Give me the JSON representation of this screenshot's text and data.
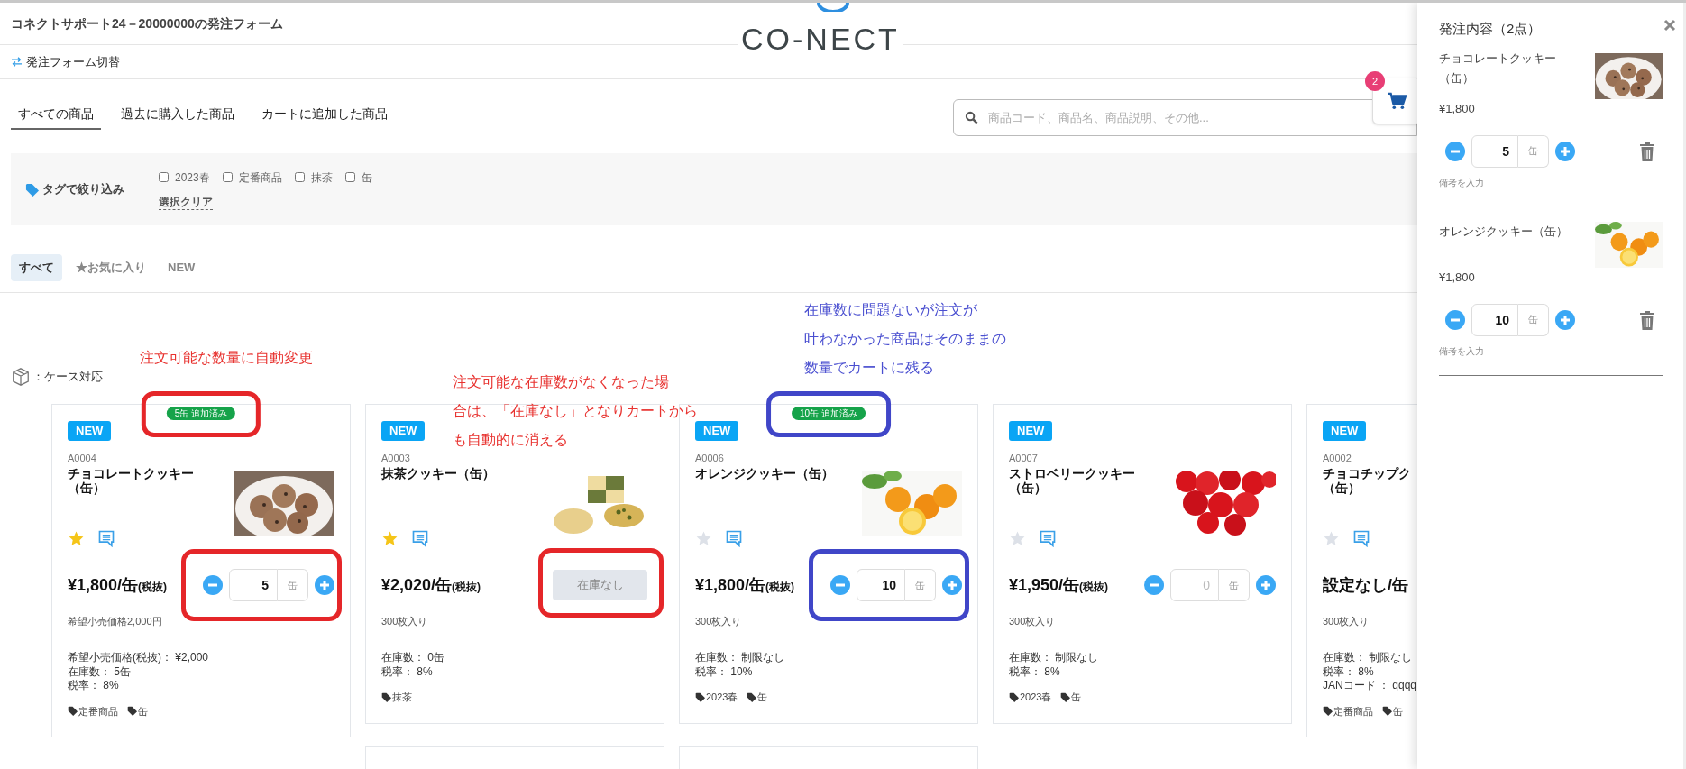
{
  "header": {
    "title": "コネクトサポート24－20000000の発注フォーム",
    "logo": "CO-NECT",
    "form_switch": "発注フォーム切替"
  },
  "tabs": [
    {
      "label": "すべての商品",
      "selected": true
    },
    {
      "label": "過去に購入した商品",
      "selected": false
    },
    {
      "label": "カートに追加した商品",
      "selected": false
    }
  ],
  "search": {
    "placeholder": "商品コード、商品名、商品説明、その他..."
  },
  "cart_button": {
    "count": "2"
  },
  "tag_filter": {
    "label": "タグで絞り込み",
    "tags": [
      {
        "label": "2023春",
        "checked": false
      },
      {
        "label": "定番商品",
        "checked": false
      },
      {
        "label": "抹茶",
        "checked": false
      },
      {
        "label": "缶",
        "checked": false
      }
    ],
    "clear": "選択クリア"
  },
  "filters": [
    {
      "label": "すべて",
      "selected": true
    },
    {
      "label": "★お気に入り",
      "selected": false
    },
    {
      "label": "NEW",
      "selected": false
    }
  ],
  "legend": "：ケース対応",
  "annotations": [
    {
      "lines": [
        "注文可能な数量に自動変更"
      ],
      "color": "#e8322f"
    },
    {
      "lines": [
        "注文可能な在庫数がなくなった場",
        "合は、「在庫なし」となりカートから",
        "も自動的に消える"
      ],
      "color": "#e8322f"
    },
    {
      "lines": [
        "在庫数に問題ないが注文が",
        "叶わなかった商品はそのままの",
        "数量でカートに残る"
      ],
      "color": "#4a4fd0"
    }
  ],
  "products": [
    {
      "badge": "NEW",
      "added": "5缶 追加済み",
      "code": "A0004",
      "name_lines": [
        "チョコレートクッキー",
        "（缶）"
      ],
      "image": {
        "kind": "picture"
      },
      "favorite": true,
      "price": "¥1,800/缶",
      "tax": "(税抜)",
      "control": {
        "kind": "quantity",
        "value": "5",
        "unit": "缶"
      },
      "description": "希望小売価格2,000円",
      "details": [
        "希望小売価格(税抜)： ¥2,000",
        "在庫数： 5缶",
        "税率： 8%"
      ],
      "tags": [
        "定番商品",
        "缶"
      ],
      "frames": [
        {
          "kind": "added",
          "color": "#e52629"
        },
        {
          "kind": "control",
          "color": "#e52629"
        }
      ]
    },
    {
      "badge": "NEW",
      "code": "A0003",
      "name_lines": [
        "抹茶クッキー（缶）"
      ],
      "image": {
        "kind": "picture"
      },
      "favorite": true,
      "price": "¥2,020/缶",
      "tax": "(税抜)",
      "control": {
        "kind": "sold_out",
        "label": "在庫なし"
      },
      "description": "300枚入り",
      "details": [
        "在庫数： 0缶",
        "税率： 8%"
      ],
      "tags": [
        "抹茶"
      ],
      "frames": [
        {
          "kind": "control",
          "color": "#e52629"
        }
      ]
    },
    {
      "badge": "NEW",
      "added": "10缶 追加済み",
      "code": "A0006",
      "name_lines": [
        "オレンジクッキー（缶）"
      ],
      "image": {
        "kind": "picture"
      },
      "favorite": false,
      "price": "¥1,800/缶",
      "tax": "(税抜)",
      "control": {
        "kind": "quantity",
        "value": "10",
        "unit": "缶"
      },
      "description": "300枚入り",
      "details": [
        "在庫数： 制限なし",
        "税率： 10%"
      ],
      "tags": [
        "2023春",
        "缶"
      ],
      "frames": [
        {
          "kind": "added",
          "color": "#4046c8"
        },
        {
          "kind": "control",
          "color": "#4046c8"
        }
      ]
    },
    {
      "badge": "NEW",
      "code": "A0007",
      "name_lines": [
        "ストロベリークッキー",
        "（缶）"
      ],
      "image": {
        "kind": "picture"
      },
      "favorite": false,
      "price": "¥1,950/缶",
      "tax": "(税抜)",
      "control": {
        "kind": "quantity",
        "placeholder": "0",
        "unit": "缶"
      },
      "description": "300枚入り",
      "details": [
        "在庫数： 制限なし",
        "税率： 8%"
      ],
      "tags": [
        "2023春",
        "缶"
      ]
    },
    {
      "badge": "NEW",
      "code": "A0002",
      "name_lines": [
        "チョコチップク",
        "（缶）"
      ],
      "favorite": false,
      "price": "設定なし/缶",
      "description": "300枚入り",
      "details": [
        "在庫数： 制限なし",
        "税率： 8%",
        "JANコード ： qqqq"
      ],
      "tags": [
        "定番商品",
        "缶"
      ]
    }
  ],
  "order_panel": {
    "title": "発注内容（2点）",
    "items": [
      {
        "name": "チョコレートクッキー（缶）",
        "image": {
          "kind": "picture"
        },
        "price": "¥1,800",
        "quantity": "5",
        "unit": "缶",
        "note_placeholder": "備考を入力"
      },
      {
        "name": "オレンジクッキー（缶）",
        "image": {
          "kind": "picture"
        },
        "price": "¥1,800",
        "quantity": "10",
        "unit": "缶",
        "note_placeholder": "備考を入力"
      }
    ]
  }
}
